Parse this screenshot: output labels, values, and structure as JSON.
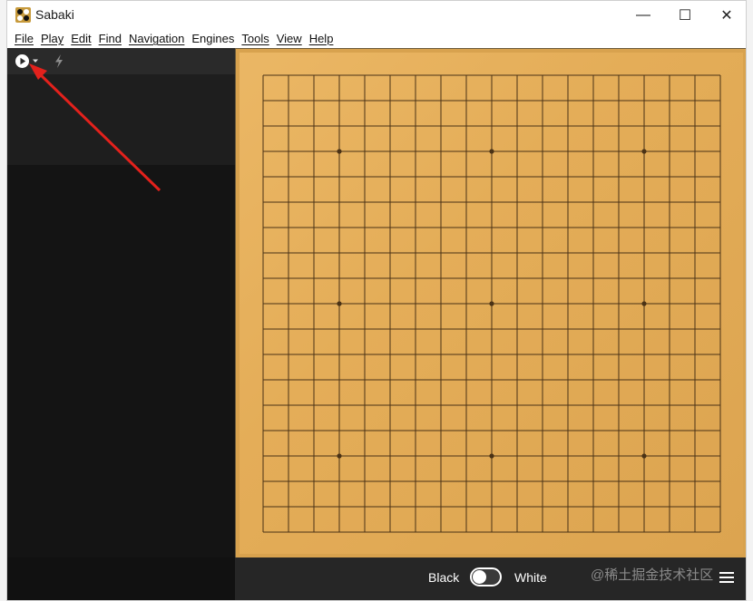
{
  "window": {
    "title": "Sabaki"
  },
  "window_controls": {
    "minimize": "—",
    "maximize": "☐",
    "close": "✕"
  },
  "menu": [
    "File",
    "Play",
    "Edit",
    "Find",
    "Navigation",
    "Engines",
    "Tools",
    "View",
    "Help"
  ],
  "sidebar": {
    "icons": [
      "play-icon",
      "chevron-down-icon",
      "bolt-icon"
    ]
  },
  "board": {
    "size": 19,
    "star_points": [
      [
        3,
        3
      ],
      [
        3,
        9
      ],
      [
        3,
        15
      ],
      [
        9,
        3
      ],
      [
        9,
        9
      ],
      [
        9,
        15
      ],
      [
        15,
        3
      ],
      [
        15,
        9
      ],
      [
        15,
        15
      ]
    ]
  },
  "status": {
    "black_label": "Black",
    "white_label": "White",
    "watermark": "@稀土掘金技术社区"
  },
  "colors": {
    "board": "#e4ad58",
    "sidebar": "#141414",
    "arrow": "#e3211c"
  }
}
